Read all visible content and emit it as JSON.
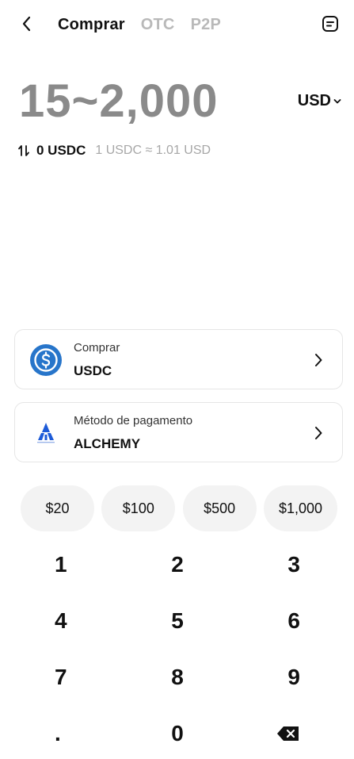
{
  "header": {
    "tabs": [
      {
        "label": "Comprar",
        "active": true
      },
      {
        "label": "OTC",
        "active": false
      },
      {
        "label": "P2P",
        "active": false
      }
    ],
    "icons": {
      "back": "chevron-left-icon",
      "orders": "document-list-icon"
    }
  },
  "amount": {
    "range": "15~2,000",
    "currency": "USD"
  },
  "conversion": {
    "amount": "0 USDC",
    "rate": "1 USDC ≈ 1.01 USD"
  },
  "asset_card": {
    "label": "Comprar",
    "value": "USDC",
    "icon": "usdc-coin-icon",
    "icon_color": "#2775CA"
  },
  "payment_card": {
    "label": "Método de pagamento",
    "value": "ALCHEMY",
    "icon": "alchemy-pay-logo"
  },
  "quick_amounts": [
    "$20",
    "$100",
    "$500",
    "$1,000"
  ],
  "keypad": {
    "rows": [
      [
        "1",
        "2",
        "3"
      ],
      [
        "4",
        "5",
        "6"
      ],
      [
        "7",
        "8",
        "9"
      ],
      [
        ".",
        "0",
        "⌫"
      ]
    ]
  },
  "colors": {
    "amount_placeholder": "#8a8a8a",
    "inactive_tab": "#b9b9b9",
    "chip_bg": "#f3f3f3",
    "border": "#e6e6e6"
  }
}
